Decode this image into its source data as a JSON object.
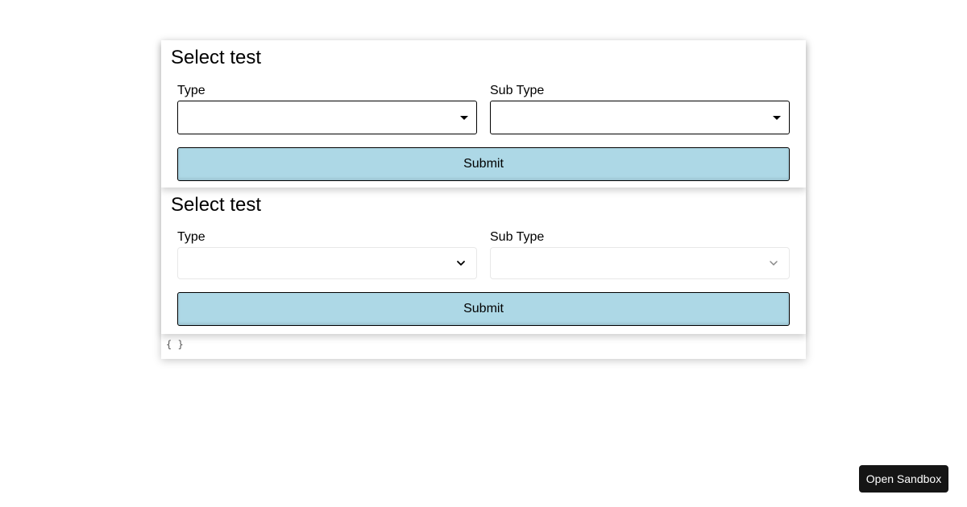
{
  "forms": [
    {
      "title": "Select test",
      "type_label": "Type",
      "subtype_label": "Sub Type",
      "type_value": "",
      "subtype_value": "",
      "submit_label": "Submit"
    },
    {
      "title": "Select test",
      "type_label": "Type",
      "subtype_label": "Sub Type",
      "type_value": "",
      "subtype_value": "",
      "submit_label": "Submit"
    }
  ],
  "output": {
    "json_text": "{ }"
  },
  "sandbox": {
    "button_label": "Open Sandbox"
  },
  "colors": {
    "submit_bg": "#add8e6",
    "sandbox_bg": "#151515"
  },
  "icons": {
    "select_a_caret": "caret-down-icon",
    "select_b_chevron": "chevron-down-icon"
  }
}
